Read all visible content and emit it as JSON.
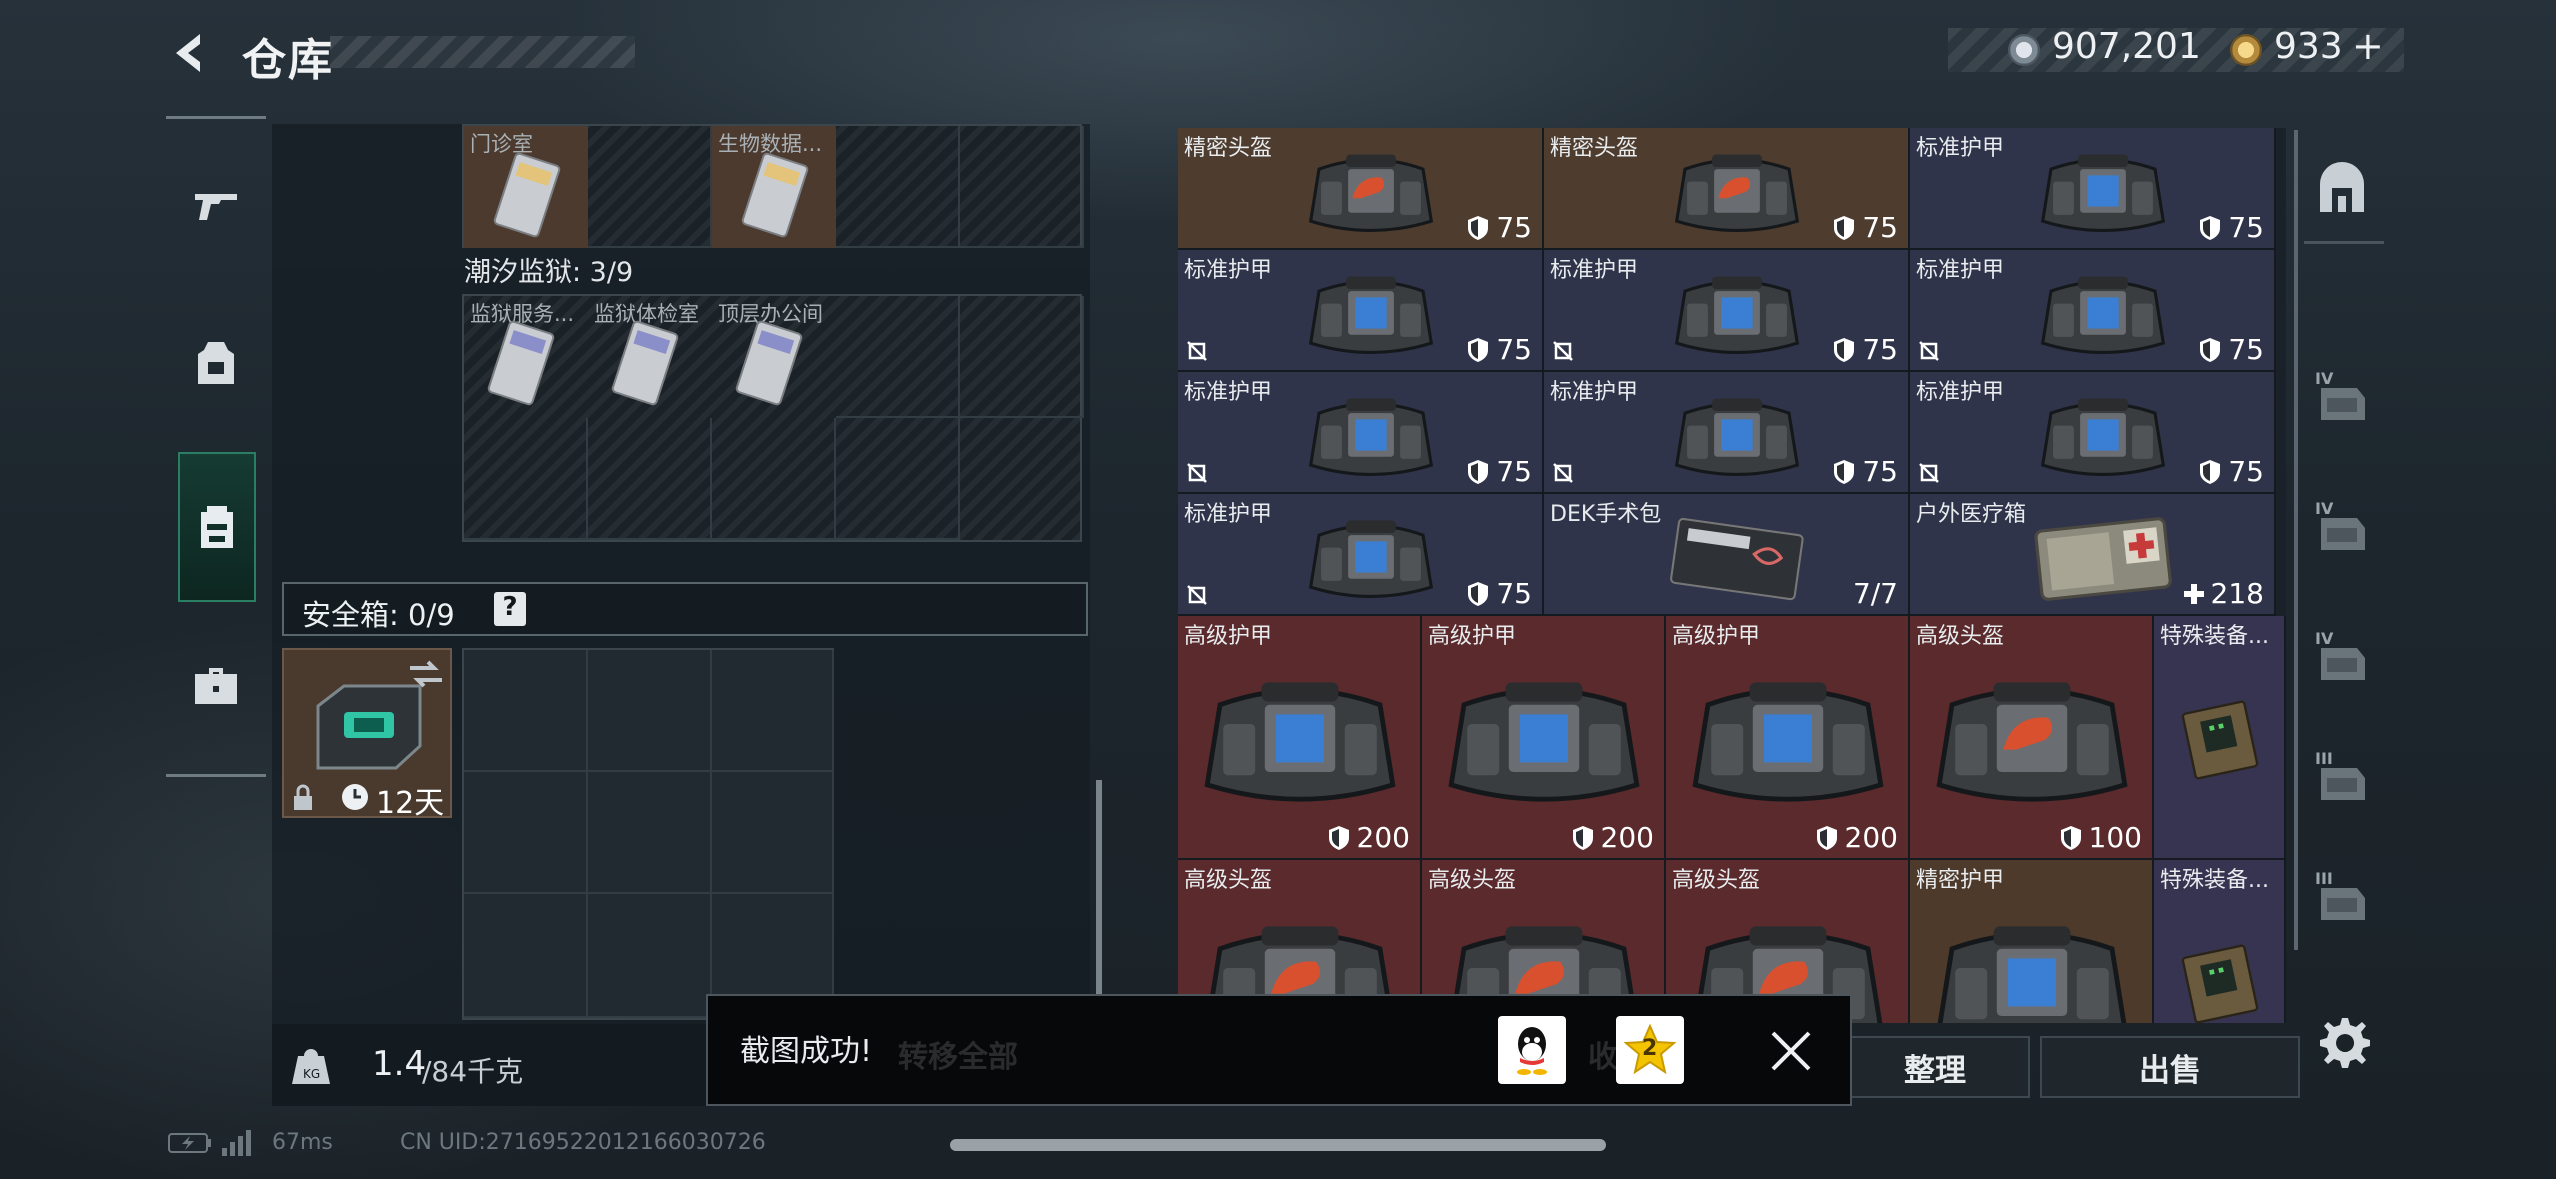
{
  "header": {
    "title": "仓库",
    "silver": "907,201",
    "gold": "933"
  },
  "nav": {
    "items": [
      "weapon",
      "armor",
      "backpack",
      "case"
    ]
  },
  "left": {
    "top_row": [
      {
        "label": "门诊室",
        "color": "brown"
      },
      {
        "label": "",
        "color": "empty"
      },
      {
        "label": "生物数据...",
        "color": "brown"
      }
    ],
    "prison_title": "潮汐监狱: 3/9",
    "prison_items": [
      {
        "label": "监狱服务..."
      },
      {
        "label": "监狱体检室"
      },
      {
        "label": "顶层办公间"
      }
    ],
    "safe_title": "安全箱: 0/9",
    "safe_help": "?",
    "safe_case_timer": "12天"
  },
  "right": {
    "rows": [
      [
        {
          "name": "精密头盔",
          "val": "75",
          "color": "brown",
          "kind": "helmet",
          "broken": false
        },
        {
          "name": "精密头盔",
          "val": "75",
          "color": "brown",
          "kind": "helmet",
          "broken": false
        },
        {
          "name": "标准护甲",
          "val": "75",
          "color": "blue",
          "kind": "armor",
          "broken": false
        }
      ],
      [
        {
          "name": "标准护甲",
          "val": "75",
          "color": "blue",
          "kind": "armor",
          "broken": true
        },
        {
          "name": "标准护甲",
          "val": "75",
          "color": "blue",
          "kind": "armor",
          "broken": true
        },
        {
          "name": "标准护甲",
          "val": "75",
          "color": "blue",
          "kind": "armor",
          "broken": true
        }
      ],
      [
        {
          "name": "标准护甲",
          "val": "75",
          "color": "blue",
          "kind": "armor",
          "broken": true
        },
        {
          "name": "标准护甲",
          "val": "75",
          "color": "blue",
          "kind": "armor",
          "broken": true
        },
        {
          "name": "标准护甲",
          "val": "75",
          "color": "blue",
          "kind": "armor",
          "broken": true
        }
      ],
      [
        {
          "name": "标准护甲",
          "val": "75",
          "color": "blue",
          "kind": "armor",
          "broken": true
        },
        {
          "name": "DEK手术包",
          "val": "7/7",
          "color": "blue",
          "kind": "kit",
          "broken": false
        },
        {
          "name": "户外医疗箱",
          "val": "218",
          "color": "blue",
          "kind": "medbox",
          "broken": false
        }
      ]
    ],
    "big_row1": [
      {
        "name": "高级护甲",
        "val": "200",
        "color": "red",
        "kind": "armor"
      },
      {
        "name": "高级护甲",
        "val": "200",
        "color": "red",
        "kind": "armor"
      },
      {
        "name": "高级护甲",
        "val": "200",
        "color": "red",
        "kind": "armor"
      },
      {
        "name": "高级头盔",
        "val": "100",
        "color": "red",
        "kind": "helmet"
      },
      {
        "name": "特殊装备...",
        "val": "",
        "color": "violet",
        "kind": "device"
      }
    ],
    "big_row2": [
      {
        "name": "高级头盔",
        "color": "red",
        "kind": "helmet"
      },
      {
        "name": "高级头盔",
        "color": "red",
        "kind": "helmet"
      },
      {
        "name": "高级头盔",
        "color": "red",
        "kind": "helmet"
      },
      {
        "name": "精密护甲",
        "color": "gold",
        "kind": "armor"
      },
      {
        "name": "特殊装备...",
        "color": "violet",
        "kind": "device"
      }
    ]
  },
  "right_nav": {
    "labels": [
      "IV",
      "IV",
      "IV",
      "III",
      "III"
    ]
  },
  "bottom": {
    "weight_value": "1.4",
    "weight_max": "/84千克",
    "transfer_all": "转移全部",
    "collect": "收",
    "arrange": "整理",
    "sell": "出售"
  },
  "toast": {
    "message": "截图成功!",
    "badge": "2"
  },
  "status": {
    "ping": "67ms",
    "uid": "CN UID:27169522012166030726"
  },
  "colors": {
    "brown": "#4e3c2e",
    "blue": "#30344a",
    "red": "#5a2a2c",
    "gold": "#4d3a2b",
    "violet": "#363450",
    "accent": "#2a7e63"
  }
}
